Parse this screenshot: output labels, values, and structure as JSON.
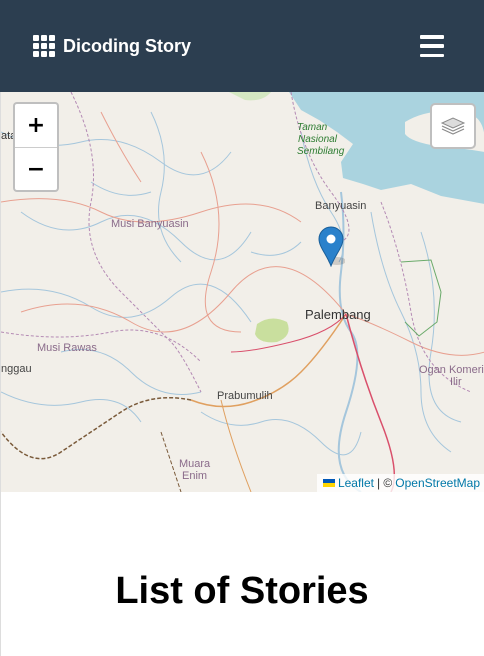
{
  "navbar": {
    "brand": "Dicoding Story",
    "brand_icon": "grid-icon",
    "menu_icon": "hamburger-icon",
    "background": "#2c3e50"
  },
  "map": {
    "zoom_in_label": "+",
    "zoom_out_label": "−",
    "layers_icon": "layers-icon",
    "marker_icon": "map-marker-icon",
    "marker_color": "#2a81cb",
    "labels": {
      "park_1": "Taman",
      "park_2": "Nasional",
      "park_3": "Sembilang",
      "banyuasin": "Banyuasin",
      "musi_banyuasin": "Musi Banyuasin",
      "palembang": "Palembang",
      "musi_rawas": "Musi Rawas",
      "lubuklinggau": "nggau",
      "prabumulih": "Prabumulih",
      "ogan_1": "Ogan Komerin",
      "ogan_2": "Ilir",
      "muara_1": "Muara",
      "muara_2": "Enim",
      "edge_top": "ata"
    },
    "attribution": {
      "leaflet": "Leaflet",
      "separator": "| ©",
      "osm": "OpenStreetMap"
    }
  },
  "main": {
    "title": "List of Stories"
  }
}
